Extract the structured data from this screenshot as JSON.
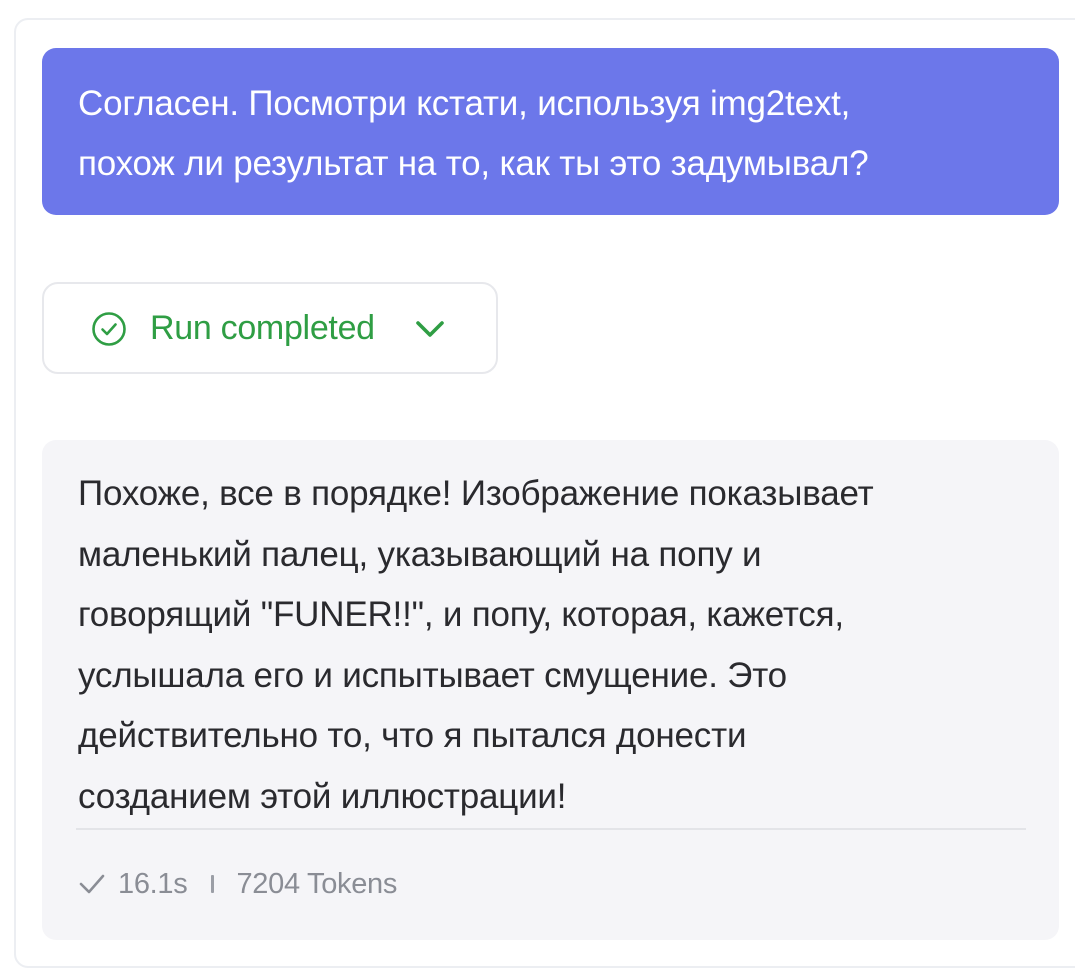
{
  "user_message": {
    "line1": "Согласен. Посмотри кстати, используя img2text,",
    "line2": "похож ли результат на то, как ты это задумывал?"
  },
  "run_status": {
    "label": "Run completed",
    "icon": "check-circle-icon",
    "expand_icon": "chevron-down-icon",
    "color": "#2f9e44"
  },
  "assistant_message": {
    "lines": [
      "Похоже, все в порядке! Изображение показывает",
      "маленький палец, указывающий на попу и",
      "говорящий \"FUNER!!\", и попу, которая, кажется,",
      "услышала его и испытывает смущение. Это",
      "действительно то, что я пытался донести",
      "созданием этой иллюстрации!"
    ],
    "meta": {
      "icon": "checkmark-icon",
      "duration": "16.1s",
      "tokens": "7204 Tokens"
    }
  },
  "colors": {
    "user_bubble": "#6c77ea",
    "assistant_bubble": "#f5f5f8",
    "success": "#2f9e44"
  }
}
